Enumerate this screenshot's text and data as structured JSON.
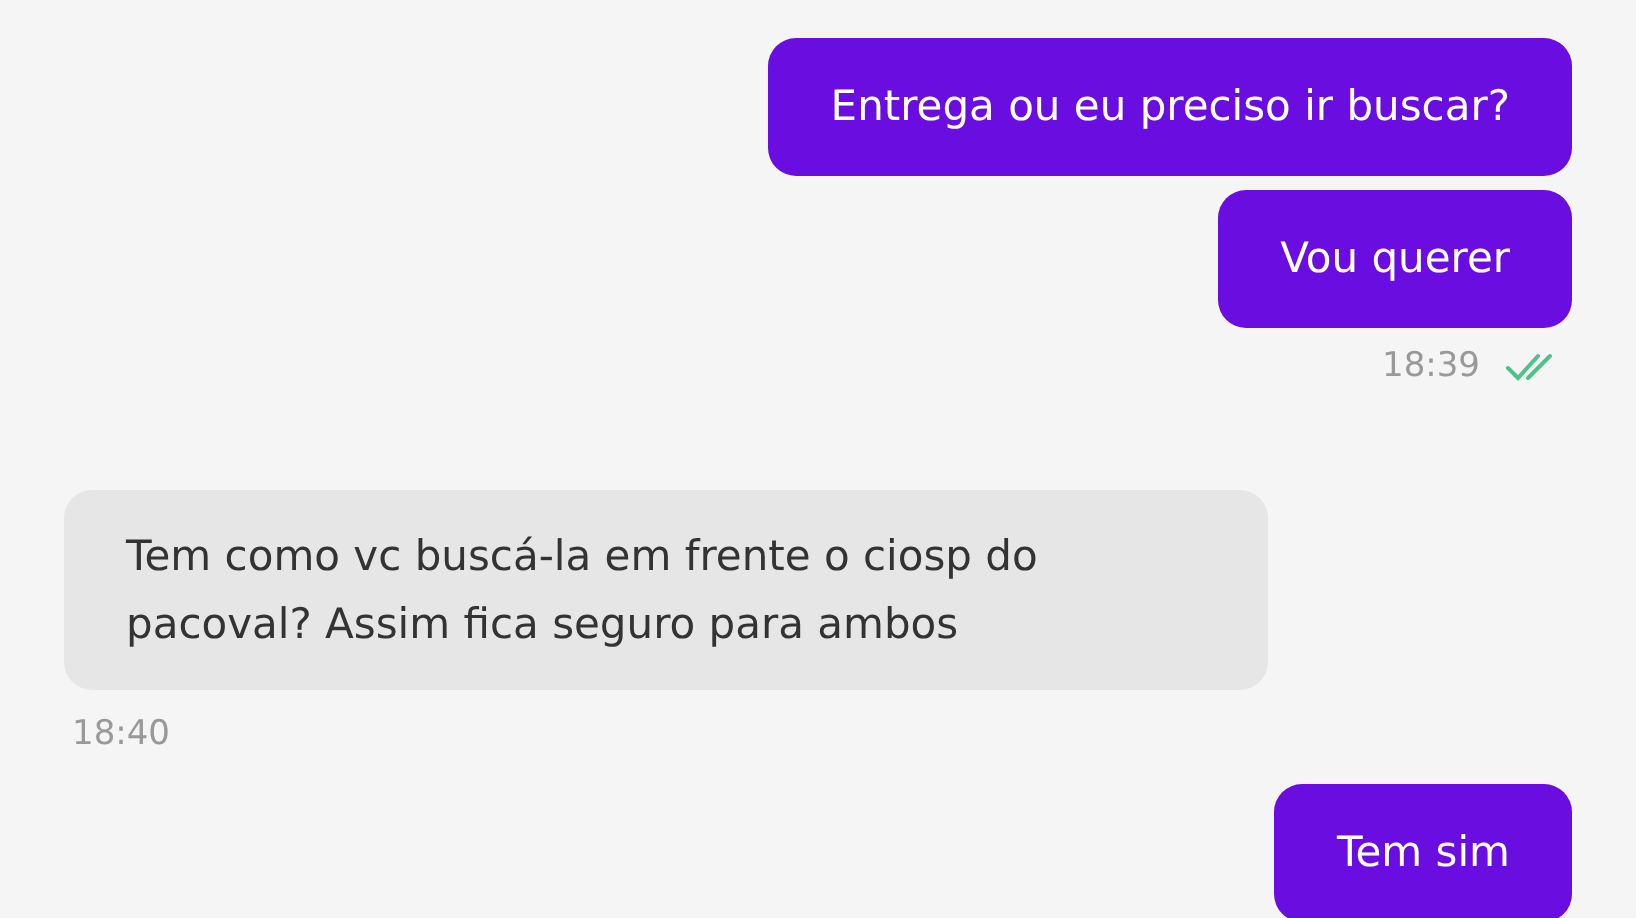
{
  "messages": [
    {
      "kind": "sent",
      "text": "Entrega ou eu preciso ir buscar?"
    },
    {
      "kind": "sent",
      "text": "Vou querer",
      "time": "18:39",
      "read": true
    },
    {
      "kind": "received",
      "text": "Tem como vc buscá-la em frente o ciosp do pacoval? Assim fica seguro para ambos",
      "time": "18:40"
    },
    {
      "kind": "sent",
      "text": "Tem sim"
    }
  ]
}
